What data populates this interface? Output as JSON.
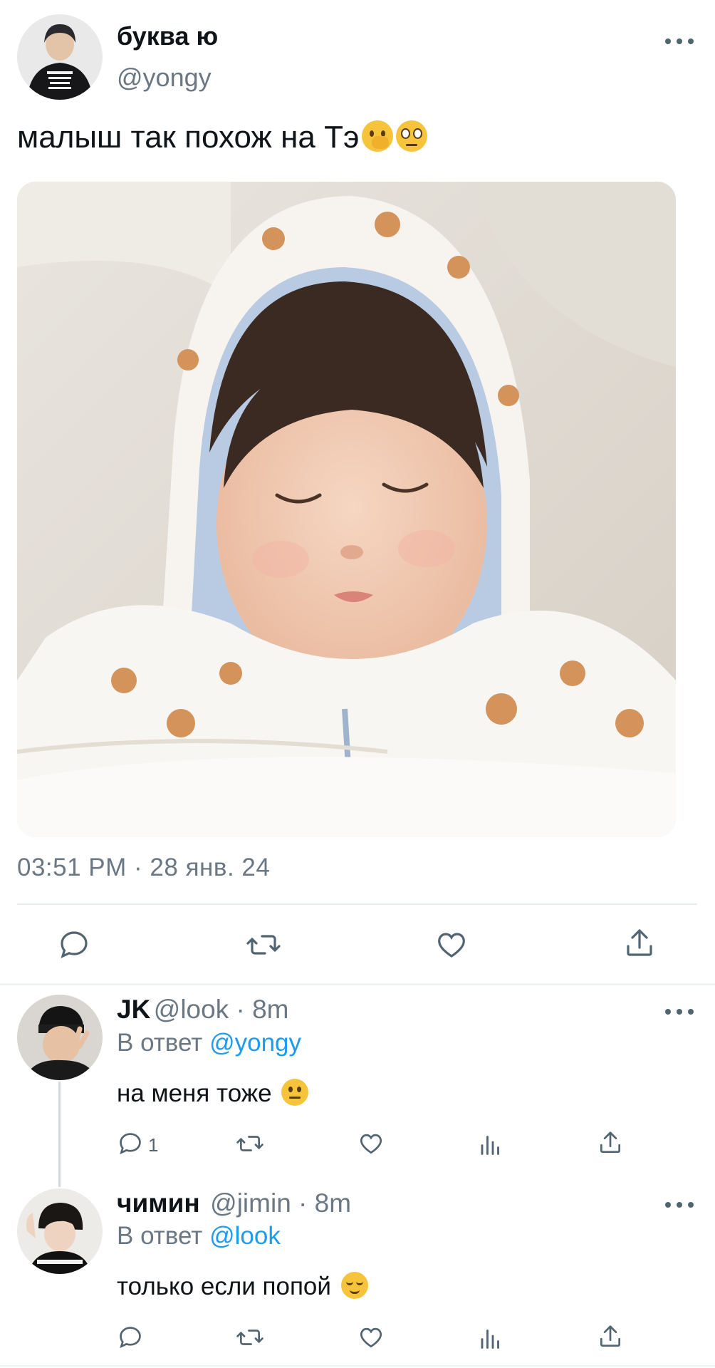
{
  "tweet": {
    "display_name": "буква ю",
    "handle": "@yongy",
    "text": "малыш так похож на Тэ",
    "timestamp": "03:51 PM · 28 янв. 24"
  },
  "replies": [
    {
      "name": "JK",
      "meta": "@look · 8m",
      "reply_prefix": "В ответ",
      "reply_to": "@yongy",
      "text": "на меня тоже",
      "reply_count": "1"
    },
    {
      "name": "чимин",
      "meta": "@jimin · 8m",
      "reply_prefix": "В ответ",
      "reply_to": "@look",
      "text": "только если попой",
      "reply_count": ""
    }
  ],
  "colors": {
    "accent": "#1d9bf0",
    "secondary_text": "#6b7782",
    "icon": "#536471"
  },
  "icons": [
    "more-icon",
    "reply-icon",
    "retweet-icon",
    "like-icon",
    "views-icon",
    "share-icon"
  ]
}
